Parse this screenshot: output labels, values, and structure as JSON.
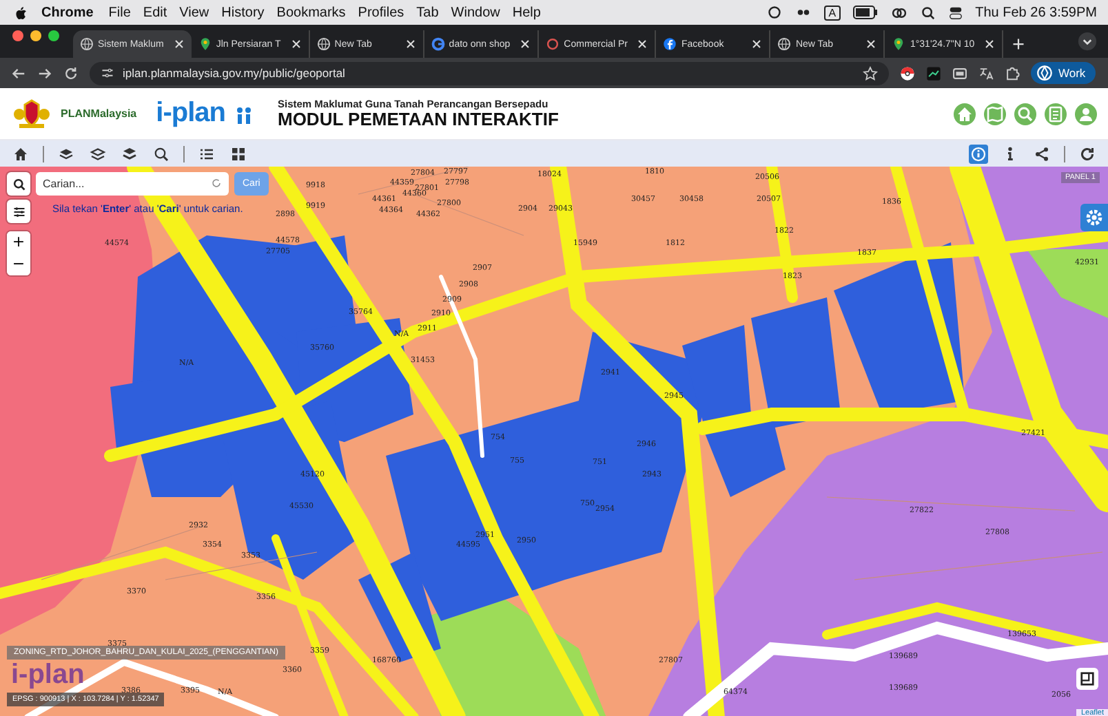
{
  "menu_bar": {
    "app": "Chrome",
    "menus": [
      "File",
      "Edit",
      "View",
      "History",
      "Bookmarks",
      "Profiles",
      "Tab",
      "Window",
      "Help"
    ],
    "input_source": "A",
    "clock": "Thu Feb 26  3:59PM"
  },
  "tabs": [
    {
      "title": "Sistem Maklum",
      "selected": true
    },
    {
      "title": "Jln Persiaran T",
      "selected": false
    },
    {
      "title": "New Tab",
      "selected": false
    },
    {
      "title": "dato onn shop",
      "selected": false
    },
    {
      "title": "Commercial Pr",
      "selected": false
    },
    {
      "title": "Facebook",
      "selected": false
    },
    {
      "title": "New Tab",
      "selected": false
    },
    {
      "title": "1°31'24.7\"N 10",
      "selected": false
    }
  ],
  "address_bar": {
    "url": "iplan.planmalaysia.gov.my/public/geoportal",
    "profile": "Work"
  },
  "header": {
    "agency": "PLANMalaysia",
    "app_logo": "i-plan",
    "subtitle": "Sistem Maklumat Guna Tanah Perancangan Bersepadu",
    "title": "MODUL PEMETAAN INTERAKTIF"
  },
  "toolbar_right": [
    {
      "selected": true
    },
    {
      "selected": false
    },
    {
      "selected": false
    }
  ],
  "search": {
    "placeholder": "Carian...",
    "button": "Cari",
    "hint": "Sila tekan '**Enter**' atau '**Cari**' untuk carian."
  },
  "map": {
    "panel_label": "PANEL 1",
    "zoom_controls": [
      "+",
      "−"
    ],
    "layer_label": "ZONING_RTD_JOHOR_BAHRU_DAN_KULAI_2025_(PENGGANTIAN)",
    "coordinates": "EPSG : 900913 | X : 103.7284 | Y : 1.52347",
    "map_logo": "i-plan",
    "attribution": "Leaflet",
    "parcels": [
      "44359",
      "27804",
      "27797",
      "27798",
      "44360",
      "27801",
      "27800",
      "44361",
      "44362",
      "44364",
      "18024",
      "2904",
      "29043",
      "1810",
      "30457",
      "30458",
      "20506",
      "20507",
      "1836",
      "1822",
      "15949",
      "1812",
      "1837",
      "1823",
      "42931",
      "44574",
      "2898",
      "9918",
      "9919",
      "44578",
      "27705",
      "2907",
      "2908",
      "2909",
      "2910",
      "2911",
      "31453",
      "2941",
      "35760",
      "35764",
      "N/A",
      "N/A",
      "754",
      "755",
      "2945",
      "2946",
      "2943",
      "751",
      "750",
      "2950",
      "2951",
      "2932",
      "3354",
      "3353",
      "3370",
      "3356",
      "3359",
      "3360",
      "3375",
      "3386",
      "3395",
      "N/A",
      "168760",
      "27807",
      "64374",
      "139689",
      "139689",
      "139653",
      "2056",
      "27421",
      "27822",
      "27808",
      "45120",
      "45530",
      "44595",
      "2954"
    ]
  }
}
